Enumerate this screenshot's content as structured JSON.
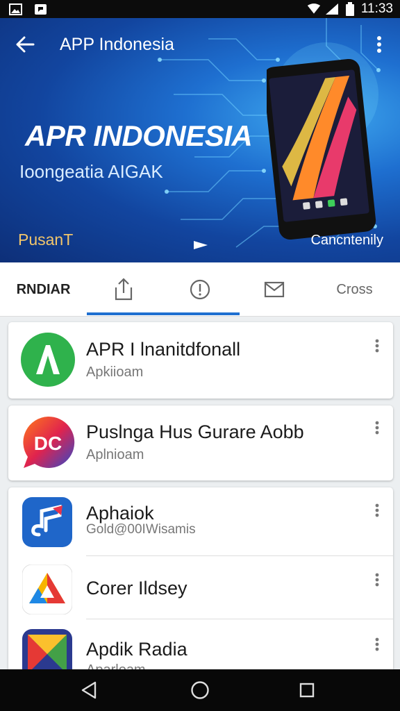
{
  "status_bar": {
    "time": "11:33",
    "icons": [
      "image-icon",
      "notification-icon",
      "wifi-icon",
      "signal-icon",
      "battery-icon"
    ]
  },
  "app_bar": {
    "title": "APP Indonesia",
    "icons": [
      "back-arrow-icon",
      "more-vert-icon"
    ]
  },
  "hero": {
    "title": "APR INDONESIA",
    "subtitle": "Ioongeatia AIGAK",
    "left_label": "PusanT",
    "right_label": "Cancntenily"
  },
  "tabs": [
    {
      "label": "RNDIAR",
      "icon": null,
      "active": false
    },
    {
      "label": "",
      "icon": "share-icon",
      "active": true
    },
    {
      "label": "",
      "icon": "info-icon",
      "active": true
    },
    {
      "label": "",
      "icon": "mail-icon",
      "active": false
    },
    {
      "label": "Cross",
      "icon": null,
      "active": false
    }
  ],
  "apps": [
    {
      "name": "APR I lnanitdfonall",
      "subtitle": "Apkiioam",
      "icon": "green-a-app-icon"
    },
    {
      "name": "Puslnga Hus Gurare Aobb",
      "subtitle": "Aplnioam",
      "icon": "dc-chat-app-icon"
    },
    {
      "name": "Aphaiok",
      "subtitle": "Gold@00IWisamis",
      "icon": "blue-music-app-icon"
    },
    {
      "name": "Corer Ildsey",
      "subtitle": "",
      "icon": "triangle-logo-app-icon"
    },
    {
      "name": "Apdik Radia",
      "subtitle": "Aparloam",
      "icon": "colorful-x-app-icon"
    }
  ],
  "nav_bar": {
    "icons": [
      "back-triangle-icon",
      "home-circle-icon",
      "recents-square-icon"
    ]
  },
  "colors": {
    "accent": "#1e6fd0",
    "hero_dark": "#0d2f78",
    "hero_light": "#3fa9ef",
    "gold": "#f2c66b"
  }
}
